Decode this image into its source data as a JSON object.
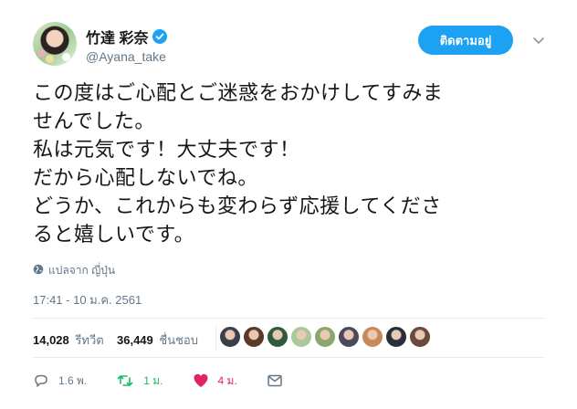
{
  "user": {
    "display_name": "竹達 彩奈",
    "handle": "@Ayana_take",
    "verified": true,
    "follow_label": "ติดตามอยู่"
  },
  "tweet": {
    "text": "この度はご心配とご迷惑をおかけしてすみま\nせんでした。\n私は元気です！大丈夫です！\nだから心配しないでね。\nどうか、これからも変わらず応援してくださ\nると嬉しいです。",
    "translate_label": "แปลจาก ญี่ปุ่น",
    "timestamp": "17:41 - 10 ม.ค. 2561"
  },
  "stats": {
    "retweets_count": "14,028",
    "retweets_label": "รีทวีต",
    "likes_count": "36,449",
    "likes_label": "ชื่นชอบ"
  },
  "actions": {
    "reply_count": "1.6 พ.",
    "retweet_count": "1 ม.",
    "like_count": "4 ม."
  },
  "liker_avatar_colors": [
    "#3a3f4a",
    "#5a3a2a",
    "#2f5a3c",
    "#a8c99a",
    "#8aa86e",
    "#4a4a5a",
    "#c98a5a",
    "#2a2e3a",
    "#6a4a3a"
  ],
  "colors": {
    "accent": "#1da1f2",
    "retweet_green": "#17bf63",
    "like_red": "#e0245e",
    "muted": "#657786"
  },
  "icons": [
    "verified-badge-icon",
    "chevron-down-icon",
    "globe-icon",
    "reply-icon",
    "retweet-icon",
    "heart-icon",
    "message-icon"
  ]
}
